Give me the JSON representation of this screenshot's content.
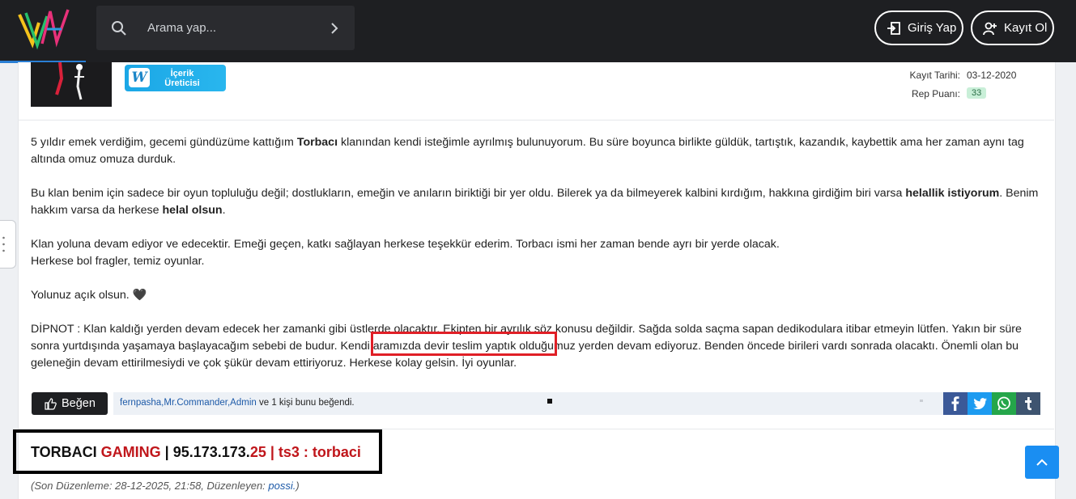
{
  "header": {
    "search_placeholder": "Arama yap...",
    "login_label": "Giriş Yap",
    "register_label": "Kayıt Ol"
  },
  "profile": {
    "badge_letter": "W",
    "badge_line1": "İçerik",
    "badge_line2": "Üreticisi",
    "kayit_label": "Kayıt Tarihi:",
    "kayit_value": "03-12-2020",
    "rep_label": "Rep Puanı:",
    "rep_value": "33"
  },
  "post": {
    "p1_a": "5 yıldır emek verdiğim, gecemi gündüzüme kattığım ",
    "p1_b": "Torbacı",
    "p1_c": " klanından kendi isteğimle ayrılmış bulunuyorum. Bu süre boyunca birlikte güldük, tartıştık, kazandık, kaybettik ama her zaman aynı tag altında omuz omuza durduk.",
    "p2_a": "Bu klan benim için sadece bir oyun topluluğu değil; dostlukların, emeğin ve anıların biriktiği bir yer oldu. Bilerek ya da bilmeyerek kalbini kırdığım, hakkına girdiğim biri varsa ",
    "p2_b": "helallik istiyorum",
    "p2_c": ". Benim hakkım varsa da herkese ",
    "p2_d": "helal olsun",
    "p2_e": ".",
    "p3_line1": "Klan yoluna devam ediyor ve edecektir. Emeği geçen, katkı sağlayan herkese teşekkür ederim. Torbacı ismi her zaman bende ayrı bir yerde olacak.",
    "p3_line2": "Herkese bol fragler, temiz oyunlar.",
    "p4": "Yolunuz açık olsun. 🖤",
    "p5": "DİPNOT : Klan kaldığı yerden devam edecek her zamanki gibi üstlerde olacaktır. Ekipten bir ayrılık söz konusu değildir. Sağda solda saçma sapan dedikodulara itibar etmeyin lütfen. Yakın bir süre sonra yurtdışında yaşamaya başlayacağım sebebi de budur. Kendi aramızda devir teslim yaptık olduğumuz yerden devam ediyoruz. Benden öncede birileri vardı sonrada olacaktı. Önemli olan bu geleneğin devam ettirilmesiydi ve çok şükür devam ettiriyoruz. Herkese kolay gelsin. İyi oyunlar."
  },
  "like": {
    "button_label": "Beğen",
    "user1": "fernpasha",
    "user2": "Mr.Commander",
    "user3": "Admin",
    "sep": ",",
    "suffix": " ve 1 kişi bunu beğendi."
  },
  "signature": {
    "part1": "TORBACI ",
    "part2": "GAMING",
    "part3": " | 95.173.173.",
    "part4": "25 | ts3 : torbaci"
  },
  "edited": {
    "prefix": "(Son Düzenleme: 28-12-2025, 21:58, Düzenleyen: ",
    "user": "possi.",
    "suffix": ")"
  },
  "colors": {
    "topbar": "#1e1f22",
    "accent_blue": "#1a8ef2",
    "highlight_red": "#e01f26",
    "signature_red": "#c0161b"
  }
}
